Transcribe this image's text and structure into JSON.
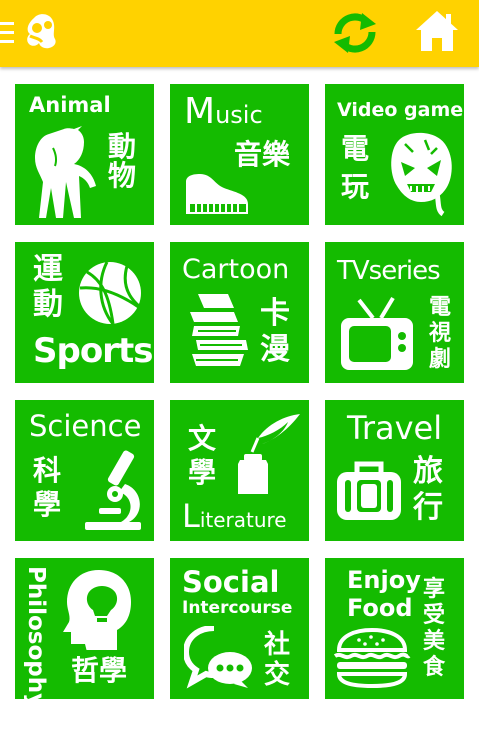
{
  "header": {
    "menu_icon": "hamburger-menu-icon",
    "logo_icon": "parent-child-logo-icon",
    "refresh_icon": "refresh-icon",
    "home_icon": "home-icon",
    "colors": {
      "bar": "#ffd200",
      "refresh": "#14bb00",
      "tile": "#14bb00"
    }
  },
  "categories": [
    {
      "en": "Animal",
      "zh": "動物"
    },
    {
      "en_big": "M",
      "en": "usic",
      "zh": "音樂"
    },
    {
      "en": "Video game",
      "zh1": "電",
      "zh2": "玩"
    },
    {
      "zh1": "運",
      "zh2": "動",
      "en": "Sports"
    },
    {
      "en": "Cartoon",
      "zh1": "卡",
      "zh2": "漫"
    },
    {
      "en": "TVseries",
      "zh1": "電",
      "zh2": "視",
      "zh3": "劇"
    },
    {
      "en": "Science",
      "zh1": "科",
      "zh2": "學"
    },
    {
      "zh1": "文",
      "zh2": "學",
      "en_big": "L",
      "en": "iterature"
    },
    {
      "en": "Travel",
      "zh1": "旅",
      "zh2": "行"
    },
    {
      "en": "Philosophy",
      "zh": "哲學"
    },
    {
      "en1": "Social",
      "en2": "Intercourse",
      "zh1": "社",
      "zh2": "交"
    },
    {
      "en1": "Enjoy",
      "en2": "Food",
      "zh1": "享",
      "zh2": "受",
      "zh3": "美",
      "zh4": "食"
    }
  ]
}
